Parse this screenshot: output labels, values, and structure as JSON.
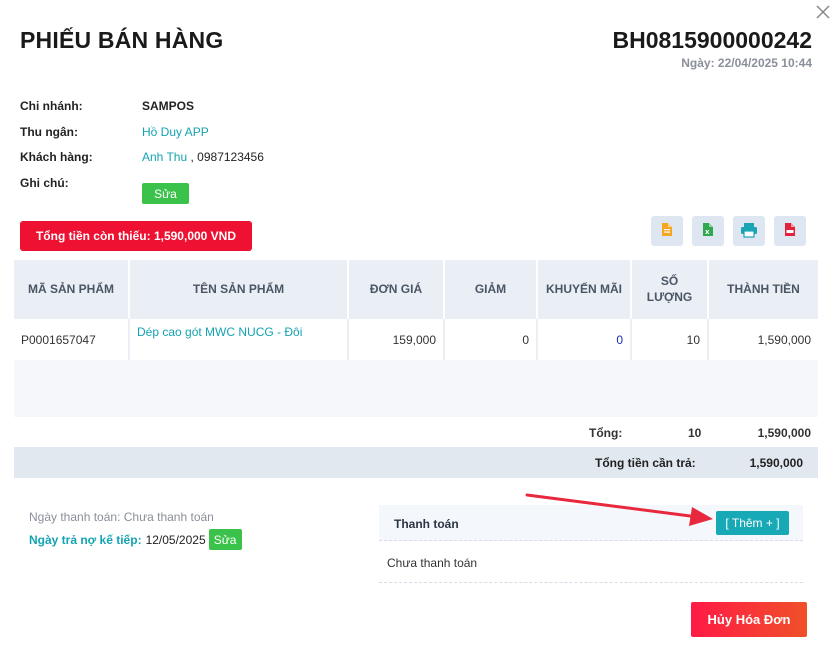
{
  "header": {
    "title": "PHIẾU BÁN HÀNG",
    "code": "BH0815900000242",
    "date": "Ngày: 22/04/2025 10:44"
  },
  "info": {
    "branch_label": "Chi nhánh:",
    "branch_value": "SAMPOS",
    "cashier_label": "Thu ngân:",
    "cashier_value": "Hồ Duy APP",
    "customer_label": "Khách hàng:",
    "customer_name": "Anh Thu",
    "customer_phone": ", 0987123456",
    "note_label": "Ghi chú:",
    "edit_label": "Sửa"
  },
  "debt_badge": "Tổng tiền còn thiếu: 1,590,000 VND",
  "export_icons": [
    "document-icon",
    "excel-icon",
    "printer-icon",
    "pdf-icon"
  ],
  "table": {
    "headers": [
      "MÃ SẢN PHẨM",
      "TÊN SẢN PHẨM",
      "ĐƠN GIÁ",
      "GIẢM",
      "KHUYẾN MÃI",
      "SỐ LƯỢNG",
      "THÀNH TIỀN"
    ],
    "rows": [
      {
        "code": "P0001657047",
        "name": "Dép cao gót MWC NUCG - Đôi",
        "unit_price": "159,000",
        "discount": "0",
        "promotion": "0",
        "quantity": "10",
        "total": "1,590,000"
      }
    ]
  },
  "summary": {
    "total_label": "Tổng:",
    "total_qty": "10",
    "total_amount": "1,590,000",
    "payable_label": "Tổng tiền cần trả:",
    "payable_amount": "1,590,000"
  },
  "payment": {
    "pay_date_text": "Ngày thanh toán: Chưa thanh toán",
    "next_due_label": "Ngày trả nợ kế tiếp:",
    "next_due_value": "12/05/2025",
    "edit_label": "Sửa",
    "section_label": "Thanh toán",
    "add_label": "[ Thêm + ]",
    "status": "Chưa thanh toán"
  },
  "actions": {
    "cancel_label": "Hủy Hóa Đơn"
  },
  "colors": {
    "accent": "#13a3b2",
    "danger": "#ee1131",
    "success": "#3bc24a",
    "header_bg": "#eaeff6"
  }
}
